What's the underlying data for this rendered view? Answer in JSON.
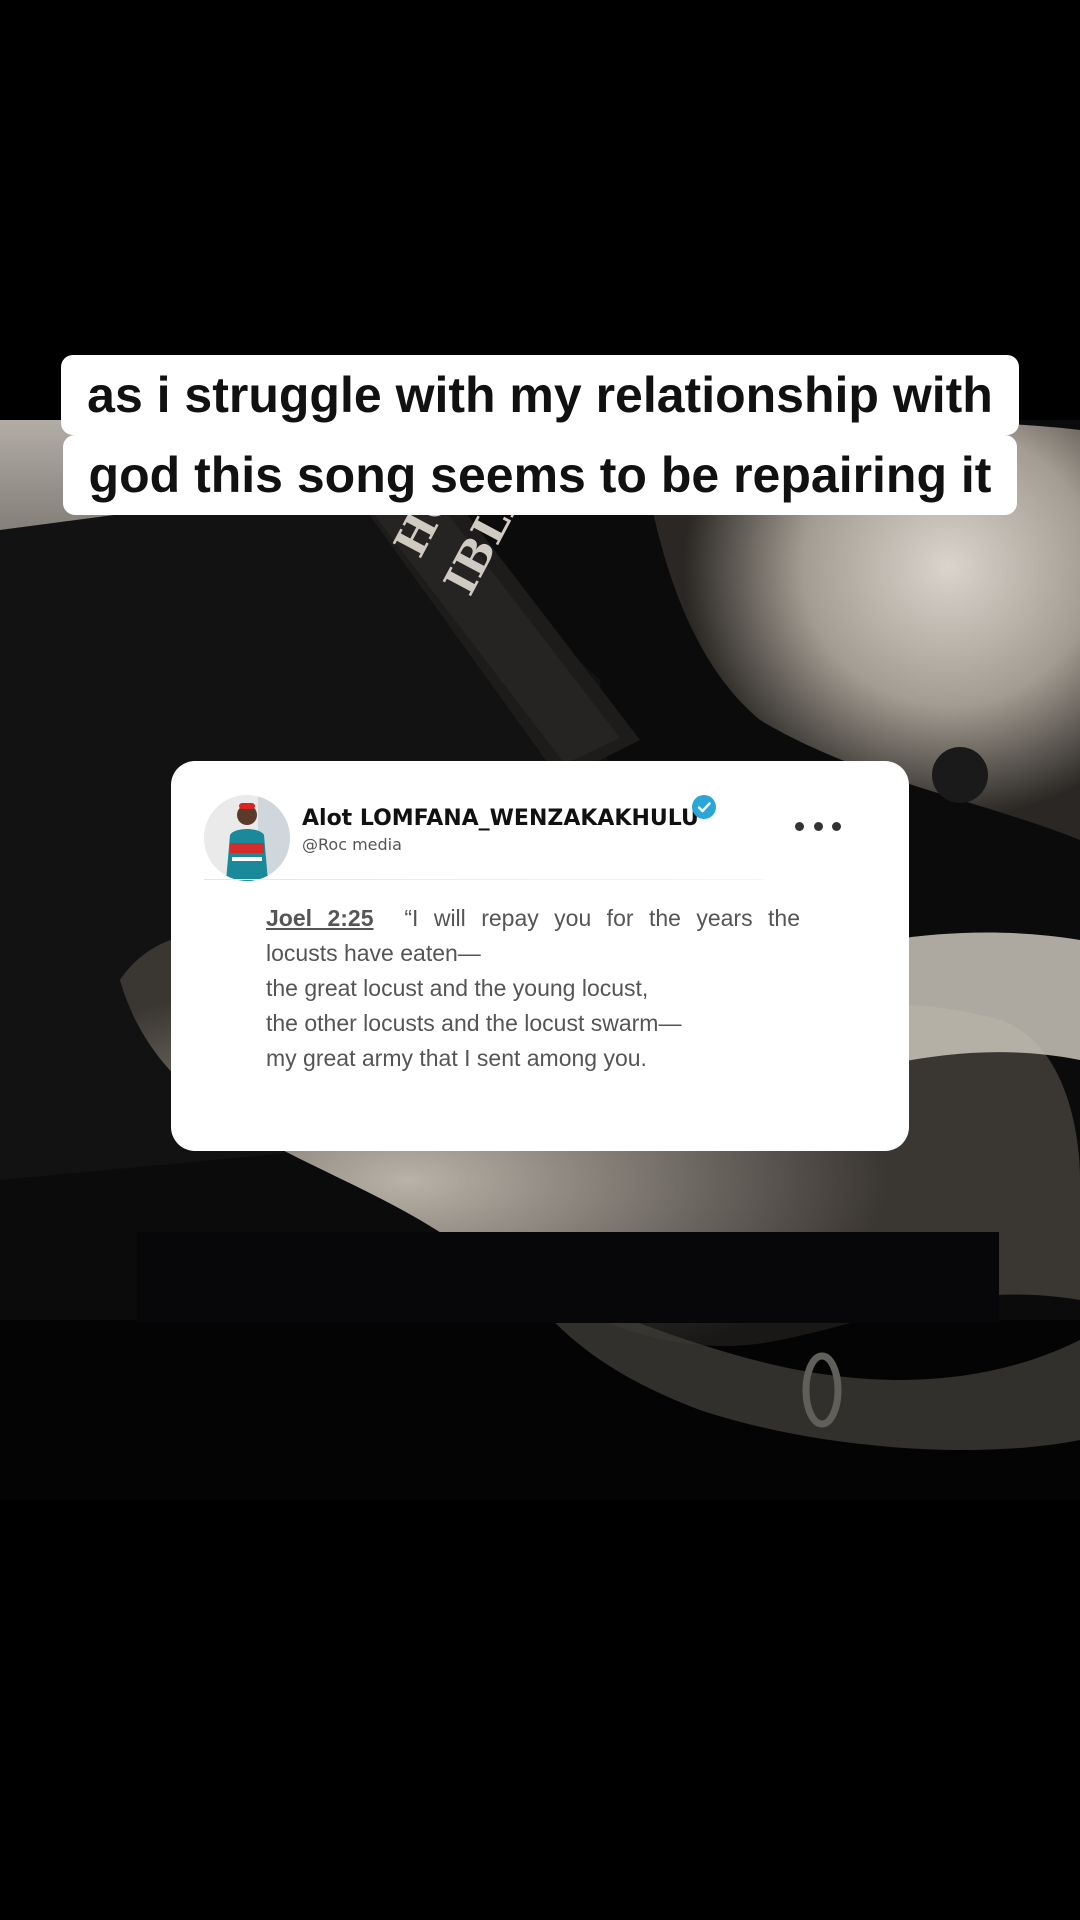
{
  "caption": {
    "line1": "as i struggle with my relationship with",
    "line2": "god this song seems to be repairing  it"
  },
  "background": {
    "book_title_line1": "HOLY",
    "book_title_line2": "IBLE"
  },
  "post": {
    "author_name": "Alot LOMFANA_WENZAKAKHULU",
    "handle": "@Roc media",
    "verified": true,
    "verified_color": "#2aa7d6",
    "more_icon": "more-horizontal-icon",
    "verse_reference": "Joel 2:25",
    "verse_first_line": "“I will repay you for the years the",
    "verse_lines": [
      "locusts have eaten—",
      "the great locust and the young locust,",
      "the other locusts and the locust swarm—",
      "my great army that I sent among you."
    ]
  }
}
